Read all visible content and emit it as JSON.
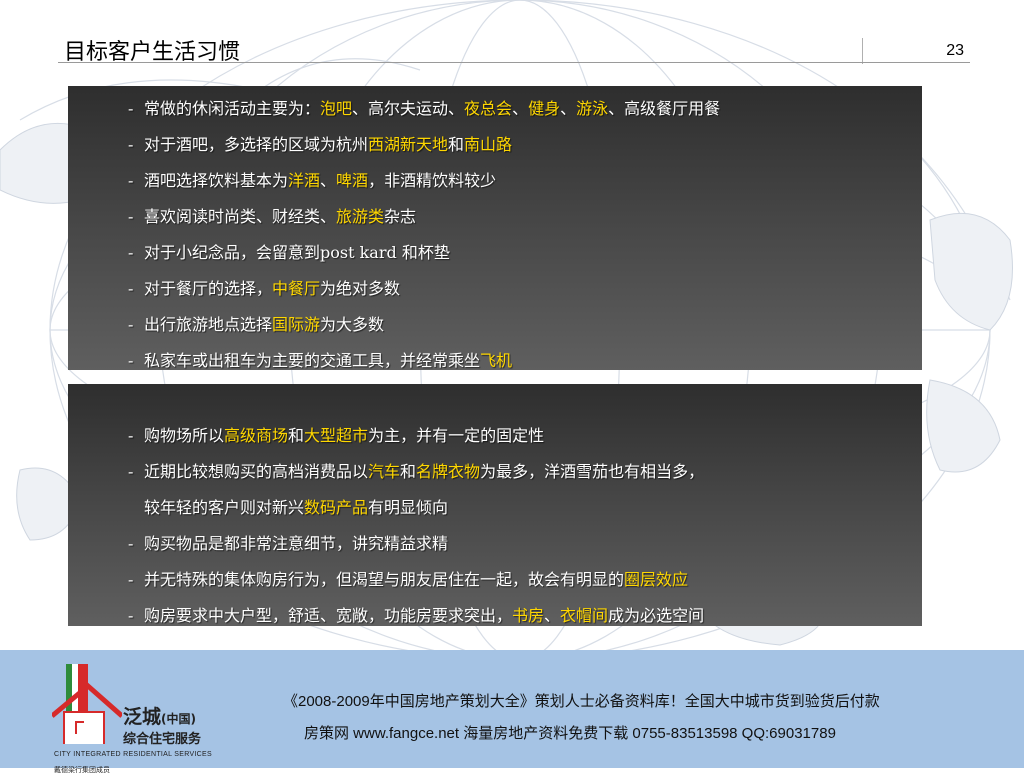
{
  "header": {
    "title": "目标客户生活习惯",
    "page_number": "23"
  },
  "panel_top": {
    "items": [
      {
        "dash": "-",
        "parts": [
          {
            "text": "常做的休闲活动主要为：",
            "highlight": false
          },
          {
            "text": "泡吧",
            "highlight": true
          },
          {
            "text": "、高尔夫运动、",
            "highlight": false
          },
          {
            "text": "夜总会",
            "highlight": true
          },
          {
            "text": "、",
            "highlight": false
          },
          {
            "text": "健身",
            "highlight": true
          },
          {
            "text": "、",
            "highlight": false
          },
          {
            "text": "游泳",
            "highlight": true
          },
          {
            "text": "、高级餐厅用餐",
            "highlight": false
          }
        ]
      },
      {
        "dash": "-",
        "parts": [
          {
            "text": "对于酒吧，多选择的区域为杭州",
            "highlight": false
          },
          {
            "text": "西湖新天地",
            "highlight": true
          },
          {
            "text": "和",
            "highlight": false
          },
          {
            "text": "南山路",
            "highlight": true
          }
        ]
      },
      {
        "dash": "-",
        "parts": [
          {
            "text": "酒吧选择饮料基本为",
            "highlight": false
          },
          {
            "text": "洋酒",
            "highlight": true
          },
          {
            "text": "、",
            "highlight": false
          },
          {
            "text": "啤酒",
            "highlight": true
          },
          {
            "text": "，非酒精饮料较少",
            "highlight": false
          }
        ]
      },
      {
        "dash": "-",
        "parts": [
          {
            "text": "喜欢阅读时尚类、财经类、",
            "highlight": false
          },
          {
            "text": "旅游类",
            "highlight": true
          },
          {
            "text": "杂志",
            "highlight": false
          }
        ]
      },
      {
        "dash": "-",
        "parts": [
          {
            "text": "对于小纪念品，会留意到post kard 和杯垫",
            "highlight": false
          }
        ]
      },
      {
        "dash": "-",
        "parts": [
          {
            "text": "对于餐厅的选择，",
            "highlight": false
          },
          {
            "text": "中餐厅",
            "highlight": true
          },
          {
            "text": "为绝对多数",
            "highlight": false
          }
        ]
      },
      {
        "dash": "-",
        "parts": [
          {
            "text": "出行旅游地点选择",
            "highlight": false
          },
          {
            "text": "国际游",
            "highlight": true
          },
          {
            "text": "为大多数",
            "highlight": false
          }
        ]
      },
      {
        "dash": "-",
        "parts": [
          {
            "text": "私家车或出租车为主要的交通工具，并经常乘坐",
            "highlight": false
          },
          {
            "text": "飞机",
            "highlight": true
          }
        ]
      }
    ]
  },
  "panel_bottom": {
    "items": [
      {
        "dash": "-",
        "parts": [
          {
            "text": "购物场所以",
            "highlight": false
          },
          {
            "text": "高级商场",
            "highlight": true
          },
          {
            "text": "和",
            "highlight": false
          },
          {
            "text": "大型超市",
            "highlight": true
          },
          {
            "text": "为主，并有一定的固定性",
            "highlight": false
          }
        ]
      },
      {
        "dash": "-",
        "parts": [
          {
            "text": "近期比较想购买的高档消费品以",
            "highlight": false
          },
          {
            "text": "汽车",
            "highlight": true
          },
          {
            "text": "和",
            "highlight": false
          },
          {
            "text": "名牌衣物",
            "highlight": true
          },
          {
            "text": "为最多，洋酒雪茄也有相当多，",
            "highlight": false
          }
        ]
      },
      {
        "dash": "",
        "parts": [
          {
            "text": "较年轻的客户则对新兴",
            "highlight": false
          },
          {
            "text": "数码产品",
            "highlight": true
          },
          {
            "text": "有明显倾向",
            "highlight": false
          }
        ]
      },
      {
        "dash": "-",
        "parts": [
          {
            "text": "购买物品是都非常注意细节，讲究精益求精",
            "highlight": false
          }
        ]
      },
      {
        "dash": "-",
        "parts": [
          {
            "text": "并无特殊的集体购房行为，但渴望与朋友居住在一起，故会有明显的",
            "highlight": false
          },
          {
            "text": "圈层效应",
            "highlight": true
          }
        ]
      },
      {
        "dash": "-",
        "parts": [
          {
            "text": "购房要求中大户型，舒适、宽敞，功能房要求突出，",
            "highlight": false
          },
          {
            "text": "书房",
            "highlight": true
          },
          {
            "text": "、",
            "highlight": false
          },
          {
            "text": "衣帽间",
            "highlight": true
          },
          {
            "text": "成为必选空间",
            "highlight": false
          }
        ]
      }
    ]
  },
  "footer": {
    "logo": {
      "name_cn": "泛城",
      "name_cn_suffix": "(中国)",
      "subtitle_cn": "综合住宅服务",
      "name_en": "CITY INTEGRATED RESIDENTIAL SERVICES",
      "member_text": "戴德梁行集团成员"
    },
    "line1": "《2008-2009年中国房地产策划大全》策划人士必备资料库！全国大中城市货到验货后付款",
    "line2": "房策网 www.fangce.net  海量房地产资料免费下载   0755-83513598  QQ:69031789"
  },
  "colors": {
    "highlight": "#ffd700",
    "panel_text": "#ffffff",
    "footer_bg": "#a5c3e4",
    "logo_red": "#d62a2a",
    "logo_green": "#2e8b3a"
  }
}
